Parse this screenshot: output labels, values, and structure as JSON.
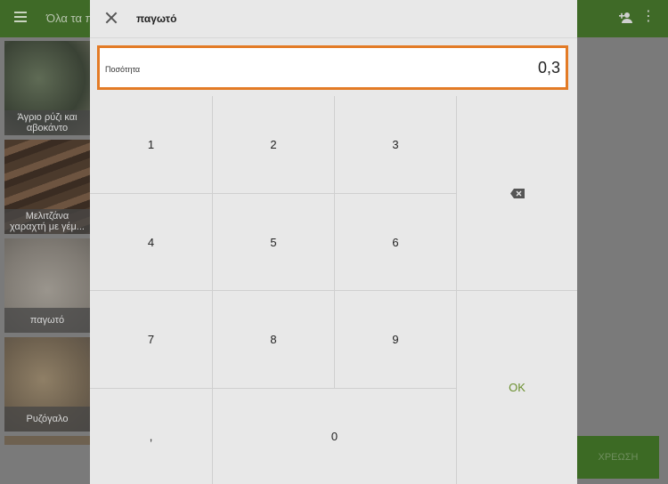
{
  "background": {
    "title": "Όλα τα πρ",
    "tiles": [
      {
        "label": "Άγριο ρύζι και αβοκάντο"
      },
      {
        "label": "Μελιτζάνα χαραχτή με γέμ..."
      },
      {
        "label": "παγωτό"
      },
      {
        "label": "Ρυζόγαλο"
      }
    ],
    "charge_label": "ΧΡΕΩΣΗ"
  },
  "dialog": {
    "title": "παγωτό",
    "quantity_label": "Ποσότητα",
    "quantity_value": "0,3",
    "keys": {
      "k1": "1",
      "k2": "2",
      "k3": "3",
      "k4": "4",
      "k5": "5",
      "k6": "6",
      "k7": "7",
      "k8": "8",
      "k9": "9",
      "comma": ",",
      "k0": "0",
      "ok": "OK"
    }
  },
  "colors": {
    "accent": "#e37b26",
    "ok": "#6a8f2e",
    "brand": "#3f6a27"
  }
}
